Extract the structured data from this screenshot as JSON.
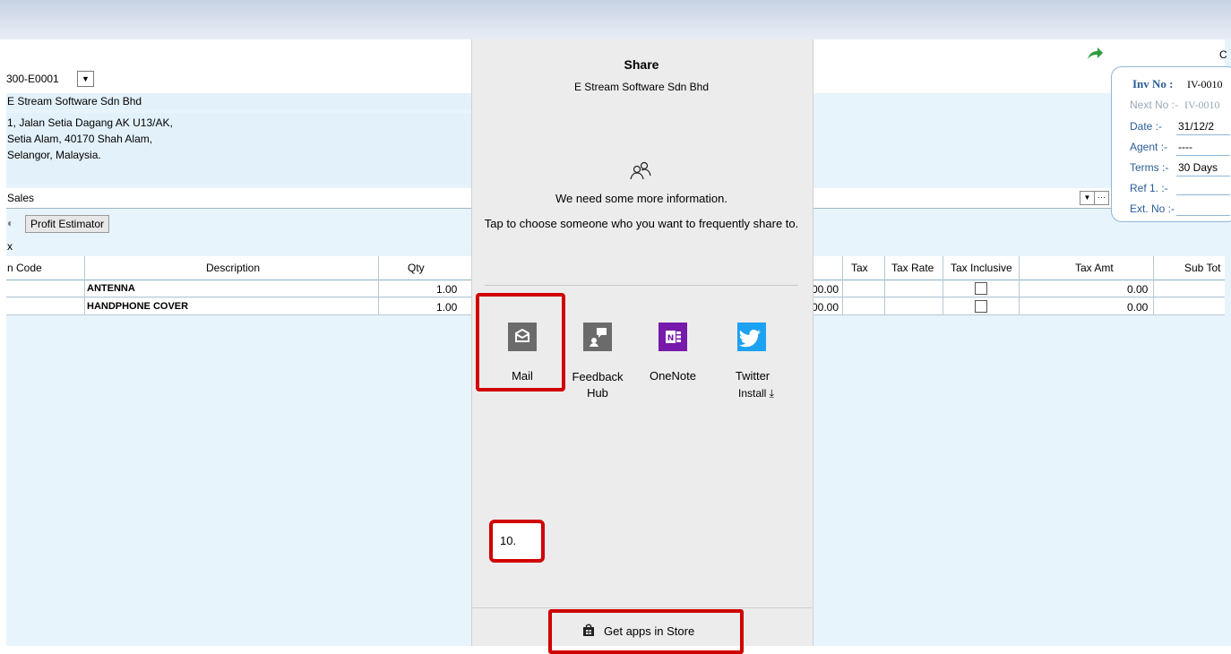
{
  "customer": {
    "code": "300-E0001",
    "name": "E Stream Software Sdn Bhd",
    "address": [
      "1, Jalan Setia Dagang AK U13/AK,",
      "Setia Alam, 40170 Shah Alam,",
      "Selangor, Malaysia."
    ]
  },
  "sales_label": "Sales",
  "profit_estimator": "Profit Estimator",
  "x_label": "x",
  "grid": {
    "headers": {
      "item_code": "n Code",
      "description": "Description",
      "qty": "Qty",
      "tax": "Tax",
      "tax_rate": "Tax Rate",
      "tax_inclusive": "Tax Inclusive",
      "tax_amt": "Tax Amt",
      "sub_total": "Sub Tot"
    },
    "rows": [
      {
        "description": "ANTENNA",
        "qty": "1.00",
        "amount": "00.00",
        "tax_amt": "0.00"
      },
      {
        "description": "HANDPHONE COVER",
        "qty": "1.00",
        "amount": "00.00",
        "tax_amt": "0.00"
      }
    ]
  },
  "invoice_card": {
    "inv_no_label": "Inv No :",
    "inv_no_value": "IV-0010",
    "next_no_label": "Next No :-",
    "next_no_value": "IV-0010",
    "date_label": "Date :-",
    "date_value": "31/12/2",
    "agent_label": "Agent :-",
    "agent_value": "----",
    "terms_label": "Terms :-",
    "terms_value": "30 Days",
    "ref_label": "Ref 1. :-",
    "ext_label": "Ext. No :-"
  },
  "top_right_glyph": "C",
  "share": {
    "title": "Share",
    "subtitle": "E Stream Software Sdn Bhd",
    "need_info": "We need some more information.",
    "tap_text": "Tap to choose someone who you want to frequently share to.",
    "apps": [
      {
        "label": "Mail",
        "color": "#6b6b6b"
      },
      {
        "label": "Feedback Hub",
        "color": "#6b6b6b"
      },
      {
        "label": "OneNote",
        "color": "#7719aa"
      },
      {
        "label": "Twitter",
        "sub": "Install ⤓",
        "color": "#1da1f2"
      }
    ],
    "store_label": "Get apps in Store"
  },
  "step_label": "10.",
  "colors": {
    "highlight": "#d00000",
    "card_border": "#8fb7d8",
    "share_bg": "#ececec"
  }
}
